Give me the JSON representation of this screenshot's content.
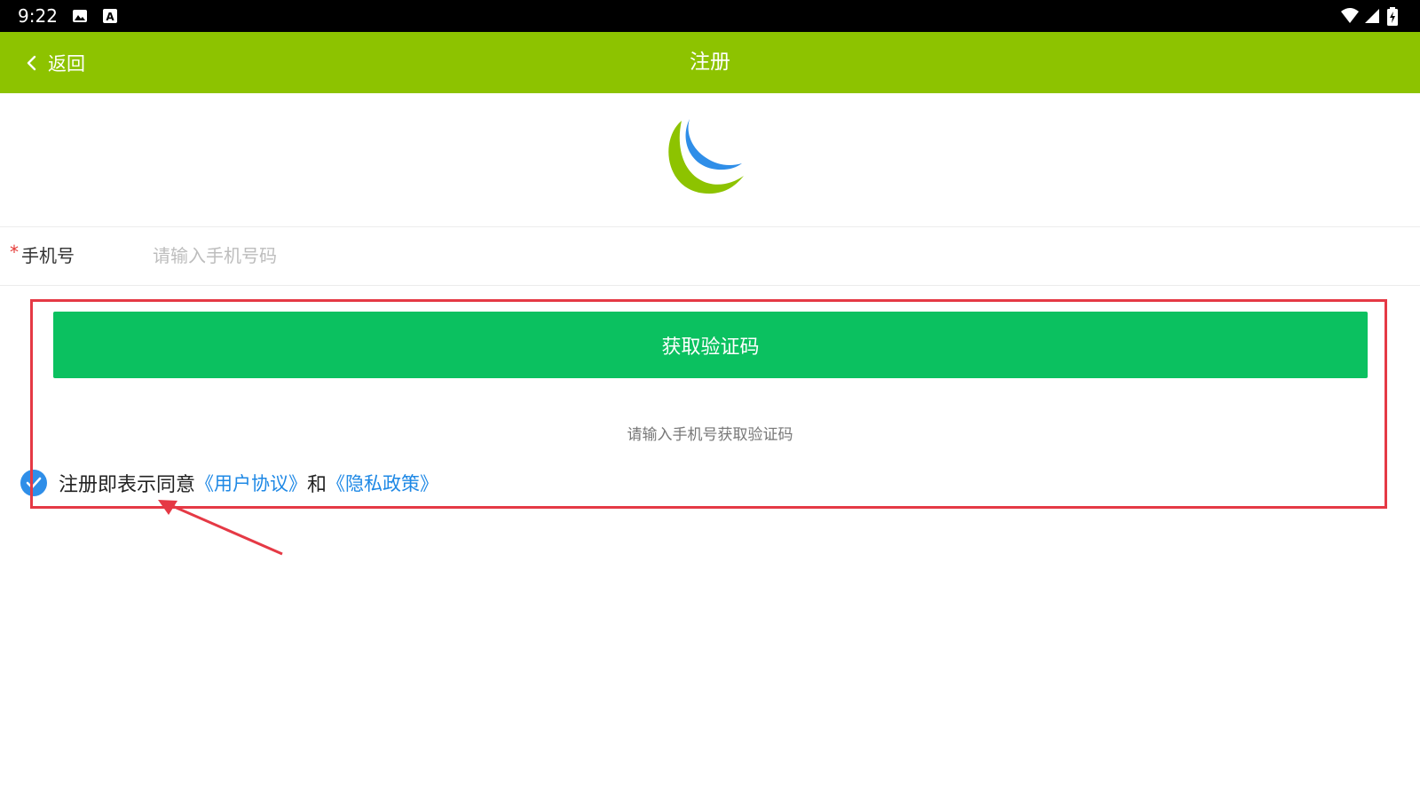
{
  "status_bar": {
    "time": "9:22",
    "icons": [
      "image-icon",
      "font-a-icon",
      "wifi-icon",
      "signal-icon",
      "battery-icon"
    ]
  },
  "app_bar": {
    "back_label": "返回",
    "title": "注册",
    "brand_color": "#8dc300"
  },
  "logo": {
    "icon": "crescent-moon-logo",
    "colors": [
      "#8dc300",
      "#2f8ee8"
    ]
  },
  "form": {
    "required_marker": "*",
    "phone_label": "手机号",
    "phone_placeholder": "请输入手机号码",
    "phone_value": ""
  },
  "actions": {
    "get_code_label": "获取验证码",
    "get_code_color": "#0bc160",
    "hint": "请输入手机号获取验证码"
  },
  "agreement": {
    "checked": true,
    "prefix": "注册即表示同意",
    "user_agreement": "《用户协议》",
    "conjunction": "和",
    "privacy_policy": "《隐私政策》",
    "link_color": "#1e88e5"
  },
  "annotation": {
    "color": "#e53945"
  }
}
